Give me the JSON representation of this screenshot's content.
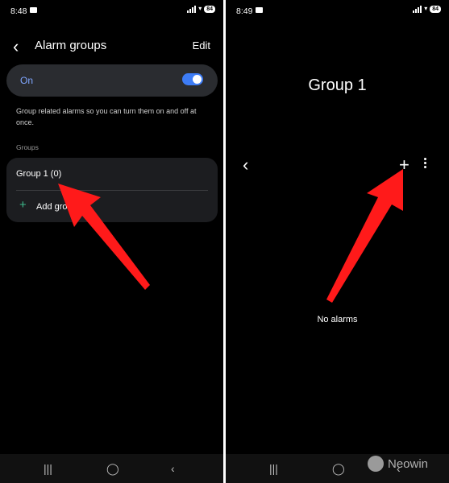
{
  "left": {
    "time": "8:48",
    "battery": "84",
    "header": {
      "title": "Alarm groups",
      "edit_label": "Edit"
    },
    "toggle": {
      "label": "On",
      "state": "on"
    },
    "description": "Group related alarms so you can turn them on and off at once.",
    "groups_header": "Groups",
    "groups": [
      {
        "label": "Group 1 (0)"
      }
    ],
    "add_group_label": "Add gro"
  },
  "right": {
    "time": "8:49",
    "battery": "84",
    "title": "Group 1",
    "empty_label": "No alarms"
  },
  "watermark": "Neowin",
  "colors": {
    "accent": "#3d7cf5",
    "add_icon": "#3dbb8c",
    "arrow": "#ff1a1a"
  },
  "icons": [
    "back-chevron-icon",
    "plus-icon",
    "more-vert-icon",
    "recent-apps-icon",
    "home-icon",
    "back-nav-icon"
  ]
}
